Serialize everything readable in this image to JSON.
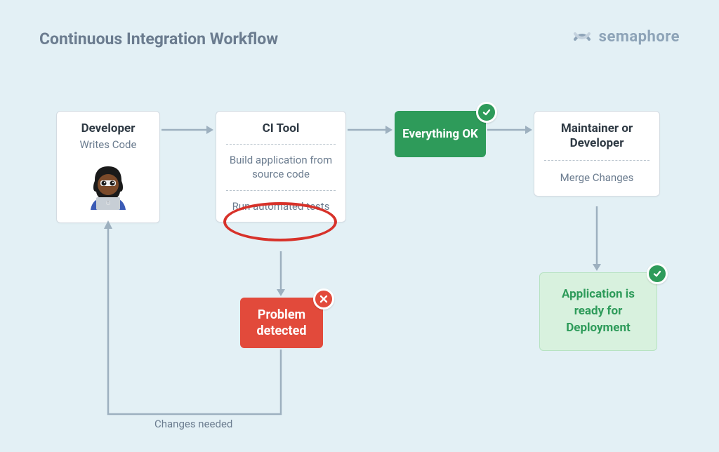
{
  "title": "Continuous Integration Workflow",
  "brand": {
    "name": "semaphore"
  },
  "nodes": {
    "developer": {
      "title": "Developer",
      "subtitle": "Writes Code"
    },
    "ci_tool": {
      "title": "CI Tool",
      "step1": "Build application from source code",
      "step2": "Run automated tests"
    },
    "everything_ok": "Everything OK",
    "maintainer": {
      "title": "Maintainer or Developer",
      "step": "Merge Changes"
    },
    "problem": "Problem detected",
    "ready": "Application is ready for Deployment"
  },
  "loop_label": "Changes needed",
  "colors": {
    "bg": "#e3f0f5",
    "arrow": "#9db0bf",
    "green": "#2e9b5a",
    "red": "#e24a3b",
    "text_muted": "#6b7c8f"
  }
}
